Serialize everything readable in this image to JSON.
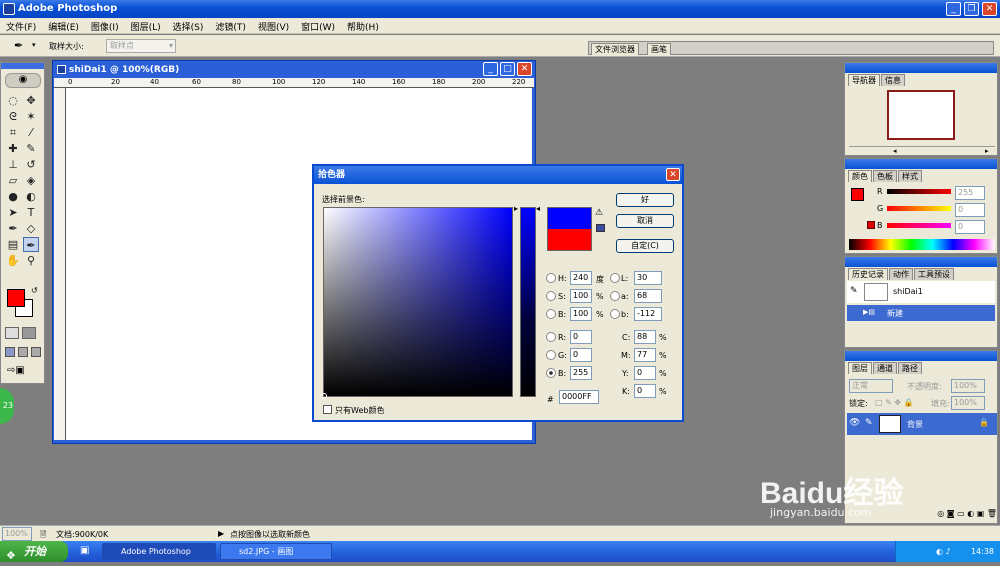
{
  "app": {
    "title": "Adobe Photoshop"
  },
  "menu": {
    "items": [
      "文件(F)",
      "编辑(E)",
      "图像(I)",
      "图层(L)",
      "选择(S)",
      "滤镜(T)",
      "视图(V)",
      "窗口(W)",
      "帮助(H)"
    ]
  },
  "options": {
    "sample_size_label": "取样大小:",
    "sample_size_value": "取样点",
    "file_browser_tab": "文件浏览器",
    "brushes_tab": "画笔"
  },
  "document": {
    "title": "shiDai1 @ 100%(RGB)",
    "ruler_h": [
      "0",
      "20",
      "40",
      "60",
      "80",
      "100",
      "120",
      "140",
      "160",
      "180",
      "200",
      "220"
    ]
  },
  "color_picker": {
    "title": "拾色器",
    "prompt": "选择前景色:",
    "ok": "好",
    "cancel": "取消",
    "custom": "自定(C)",
    "new_color": "#0000ff",
    "old_color": "#ff0000",
    "H": {
      "label": "H:",
      "value": "240",
      "unit": "度"
    },
    "S": {
      "label": "S:",
      "value": "100",
      "unit": "%"
    },
    "Bv": {
      "label": "B:",
      "value": "100",
      "unit": "%"
    },
    "R": {
      "label": "R:",
      "value": "0"
    },
    "G": {
      "label": "G:",
      "value": "0"
    },
    "B": {
      "label": "B:",
      "value": "255"
    },
    "L": {
      "label": "L:",
      "value": "30"
    },
    "a": {
      "label": "a:",
      "value": "68"
    },
    "b": {
      "label": "b:",
      "value": "-112"
    },
    "C": {
      "label": "C:",
      "value": "88",
      "unit": "%"
    },
    "M": {
      "label": "M:",
      "value": "77",
      "unit": "%"
    },
    "Y": {
      "label": "Y:",
      "value": "0",
      "unit": "%"
    },
    "K": {
      "label": "K:",
      "value": "0",
      "unit": "%"
    },
    "hex_label": "#",
    "hex": "0000FF",
    "web_only": "只有Web颜色"
  },
  "panels": {
    "navigator": {
      "tabs": [
        "导航器",
        "信息"
      ]
    },
    "color": {
      "tabs": [
        "颜色",
        "色板",
        "样式"
      ],
      "r_label": "R",
      "g_label": "G",
      "b_label": "B",
      "r": "255",
      "g": "0",
      "b": "0"
    },
    "history": {
      "tabs": [
        "历史记录",
        "动作",
        "工具预设"
      ],
      "snapshot": "shiDai1",
      "step": "新建"
    },
    "layers": {
      "tabs": [
        "图层",
        "通道",
        "路径"
      ],
      "blend_mode": "正常",
      "opacity_label": "不透明度:",
      "opacity": "100%",
      "lock_label": "锁定:",
      "fill_label": "填充:",
      "fill": "100%",
      "layer_name": "背景"
    }
  },
  "status": {
    "zoom": "100%",
    "doc_size": "文档:900K/0K",
    "hint": "点按图像以选取新颜色"
  },
  "taskbar": {
    "start": "开始",
    "task1": "Adobe Photoshop",
    "task2": "sd2.JPG - 画图",
    "time": "14:38"
  },
  "watermark": {
    "text1": "Baidu经验",
    "text2": "jingyan.baidu.com"
  },
  "colors": {
    "foreground": "#ff0000",
    "background": "#ffffff",
    "xp_blue": "#0a52d6"
  }
}
